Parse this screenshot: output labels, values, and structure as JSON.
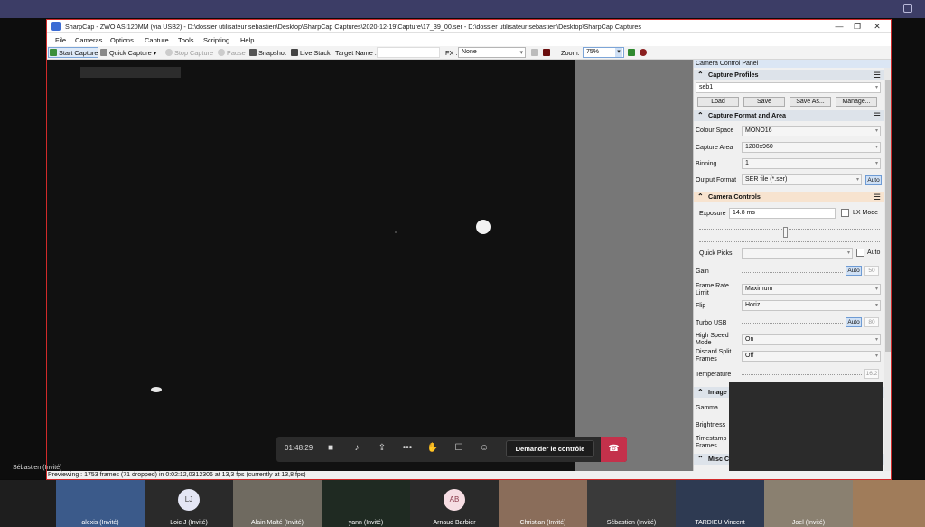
{
  "app": {
    "title": "SharpCap - ZWO ASI120MM (via USB2) - D:\\dossier utilisateur sebastien\\Desktop\\SharpCap Captures\\2020-12-19\\Capture\\17_39_00.ser - D:\\dossier utilisateur sebastien\\Desktop\\SharpCap Captures"
  },
  "window_controls": {
    "minimize": "—",
    "maximize": "❐",
    "close": "✕"
  },
  "menu": [
    "File",
    "Cameras",
    "Options",
    "Capture",
    "Tools",
    "Scripting",
    "Help"
  ],
  "toolbar": {
    "start_capture": "Start Capture",
    "quick_capture": "Quick Capture",
    "stop_capture": "Stop Capture",
    "pause": "Pause",
    "snapshot": "Snapshot",
    "live_stack": "Live Stack",
    "target_name_label": "Target Name :",
    "fx_label": "FX :",
    "fx_value": "None",
    "zoom_label": "Zoom:",
    "zoom_value": "75%"
  },
  "panel": {
    "title": "Camera Control Panel",
    "capture_profiles": {
      "header": "Capture Profiles",
      "profile": "seb1",
      "load": "Load",
      "save": "Save",
      "save_as": "Save As...",
      "manage": "Manage..."
    },
    "format": {
      "header": "Capture Format and Area",
      "colour_space_label": "Colour Space",
      "colour_space": "MONO16",
      "capture_area_label": "Capture Area",
      "capture_area": "1280x960",
      "binning_label": "Binning",
      "binning": "1",
      "output_format_label": "Output Format",
      "output_format": "SER file (*.ser)",
      "auto": "Auto"
    },
    "controls": {
      "header": "Camera Controls",
      "exposure_label": "Exposure",
      "exposure": "14.8 ms",
      "lx_mode": "LX Mode",
      "quick_picks_label": "Quick Picks",
      "quick_picks_auto": "Auto",
      "gain_label": "Gain",
      "gain_auto": "Auto",
      "gain_value": "50",
      "frame_rate_label": "Frame Rate Limit",
      "frame_rate": "Maximum",
      "flip_label": "Flip",
      "flip": "Horiz",
      "turbo_label": "Turbo USB",
      "turbo_auto": "Auto",
      "turbo_value": "80",
      "high_speed_label": "High Speed Mode",
      "high_speed": "On",
      "discard_label": "Discard Split Frames",
      "discard": "Off",
      "temperature_label": "Temperature",
      "temperature": "16.2"
    },
    "image_header": "Image C",
    "image": {
      "gamma_label": "Gamma",
      "brightness_label": "Brightness",
      "timestamp_label": "Timestamp Frames"
    },
    "misc_header": "Misc Co"
  },
  "status": "Previewing : 1753 frames (71 dropped) in 0:02:12,0312306 at 13,3 fps  (currently at 13,8 fps)",
  "call": {
    "time": "01:48:29",
    "request_control": "Demander le contrôle",
    "presenter": "Sébastien (Invité)"
  },
  "participants": [
    {
      "name": "alexis (Invité)"
    },
    {
      "name": "Loic J (Invité)",
      "initials": "LJ"
    },
    {
      "name": "Alain Malté (Invité)"
    },
    {
      "name": "yann (Invité)"
    },
    {
      "name": "Arnaud Barbier",
      "initials": "AB"
    },
    {
      "name": "Christian (Invité)"
    },
    {
      "name": "Sébastien (Invité)"
    },
    {
      "name": "TARDIEU Vincent"
    },
    {
      "name": "Joel (Invité)"
    },
    {
      "name": ""
    }
  ],
  "colors": {
    "teams_bar": "#3c3d66",
    "share_border": "#d12a2a",
    "hangup": "#c4314b",
    "section_highlight": "#f7e3cf"
  }
}
